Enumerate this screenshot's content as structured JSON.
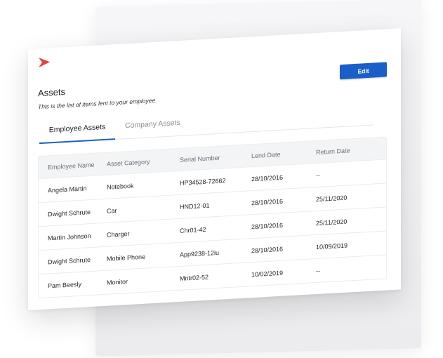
{
  "colors": {
    "accent": "#1a5fc8",
    "logo": "#e8413c"
  },
  "page": {
    "title": "Assets",
    "subtitle": "This is the list of items lent to your employee.",
    "edit_label": "Edit"
  },
  "tabs": [
    {
      "label": "Employee Assets",
      "active": true
    },
    {
      "label": "Company Assets",
      "active": false
    }
  ],
  "table": {
    "headers": [
      "Employee Name",
      "Asset Category",
      "Serial Number",
      "Lend Date",
      "Return Date"
    ],
    "rows": [
      [
        "Angela Martin",
        "Notebook",
        "HP34528-72662",
        "28/10/2016",
        "--"
      ],
      [
        "Dwight Schrute",
        "Car",
        "HND12-01",
        "28/10/2016",
        "25/11/2020"
      ],
      [
        "Martin Johnson",
        "Charger",
        "Chr01-42",
        "28/10/2016",
        "25/11/2020"
      ],
      [
        "Dwight Schrute",
        "Mobile Phone",
        "App9238-12iu",
        "28/10/2016",
        "10/09/2019"
      ],
      [
        "Pam Beesly",
        "Monitor",
        "Mntr02-52",
        "10/02/2019",
        "--"
      ]
    ]
  }
}
